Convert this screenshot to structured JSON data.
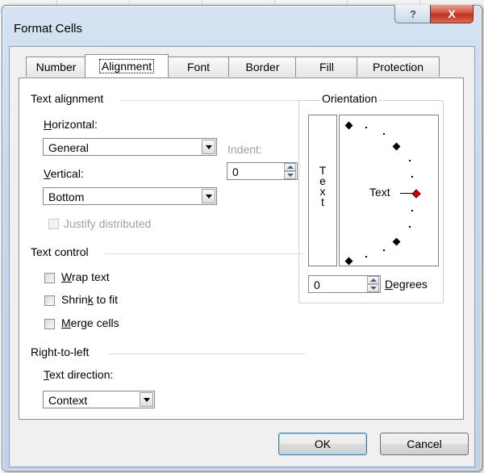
{
  "dialog": {
    "title": "Format Cells",
    "help_label": "?",
    "close_label": "X"
  },
  "tabs": [
    {
      "label": "Number"
    },
    {
      "label": "Alignment"
    },
    {
      "label": "Font"
    },
    {
      "label": "Border"
    },
    {
      "label": "Fill"
    },
    {
      "label": "Protection"
    }
  ],
  "active_tab": "Alignment",
  "text_alignment": {
    "section_title": "Text alignment",
    "horizontal_label": "Horizontal:",
    "horizontal_value": "General",
    "indent_label": "Indent:",
    "indent_value": "0",
    "vertical_label": "Vertical:",
    "vertical_value": "Bottom",
    "justify_distributed_label": "Justify distributed",
    "justify_distributed_checked": false
  },
  "text_control": {
    "section_title": "Text control",
    "wrap_text_label": "Wrap text",
    "wrap_text_checked": false,
    "shrink_to_fit_label": "Shrink to fit",
    "shrink_to_fit_checked": false,
    "merge_cells_label": "Merge cells",
    "merge_cells_checked": false
  },
  "right_to_left": {
    "section_title": "Right-to-left",
    "text_direction_label": "Text direction:",
    "text_direction_value": "Context"
  },
  "orientation": {
    "section_title": "Orientation",
    "vertical_text": [
      "T",
      "e",
      "x",
      "t"
    ],
    "dial_text": "Text",
    "degrees_value": "0",
    "degrees_label": "Degrees",
    "needle_color": "#cc0000"
  },
  "footer": {
    "ok_label": "OK",
    "cancel_label": "Cancel"
  }
}
